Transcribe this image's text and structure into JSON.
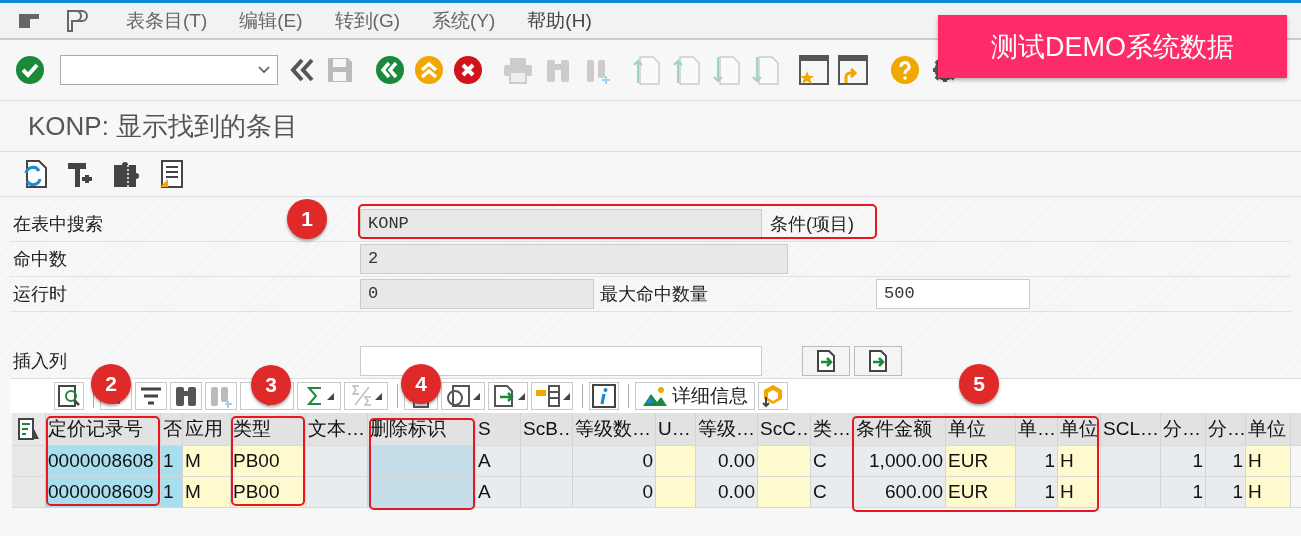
{
  "menu_bar": {
    "items": [
      "表条目(T)",
      "编辑(E)",
      "转到(G)",
      "系统(Y)",
      "帮助(H)"
    ]
  },
  "banner": {
    "text": "测试DEMO系统数据"
  },
  "title": "KONP: 显示找到的条目",
  "form": {
    "rows": [
      {
        "label": "在表中搜索",
        "fields": [
          {
            "value": "KONP",
            "disabled": true,
            "description": "条件(项目)"
          }
        ]
      },
      {
        "label": "命中数",
        "fields": [
          {
            "value": "2",
            "disabled": true
          }
        ]
      },
      {
        "label": "运行时",
        "fields": [
          {
            "value": "0",
            "disabled": true
          },
          {
            "label": "最大命中数量",
            "value": "500",
            "disabled": false
          }
        ]
      },
      {
        "label": "插入列",
        "fields": [
          {
            "disabled": false
          }
        ]
      }
    ]
  },
  "grid_toolbar": {
    "details_button": "详细信息"
  },
  "table": {
    "columns": [
      {
        "header": "定价记录号",
        "kind": "key"
      },
      {
        "header": "否",
        "kind": "key"
      },
      {
        "header": "应用",
        "kind": "input"
      },
      {
        "header": "类型",
        "kind": "input"
      },
      {
        "header": "文本…",
        "kind": "plain"
      },
      {
        "header": "删除标识",
        "kind": "marked"
      },
      {
        "header": "S",
        "kind": "plain"
      },
      {
        "header": "ScB…",
        "kind": "plain"
      },
      {
        "header": "等级数…",
        "kind": "plain"
      },
      {
        "header": "U…",
        "kind": "input"
      },
      {
        "header": "等级…",
        "kind": "plain"
      },
      {
        "header": "ScC…",
        "kind": "input"
      },
      {
        "header": "类…",
        "kind": "plain"
      },
      {
        "header": "条件金额",
        "kind": "plain"
      },
      {
        "header": "单位",
        "kind": "input"
      },
      {
        "header": "单…",
        "kind": "plain"
      },
      {
        "header": "单位",
        "kind": "input"
      },
      {
        "header": "SCL…",
        "kind": "plain"
      },
      {
        "header": "分…",
        "kind": "plain"
      },
      {
        "header": "分…",
        "kind": "plain"
      },
      {
        "header": "单位",
        "kind": "input"
      }
    ],
    "rows": [
      [
        "0000008608",
        "1",
        "M",
        "PB00",
        "",
        "",
        "A",
        "",
        "0",
        "",
        "0.00",
        "",
        "C",
        "1,000.00",
        "EUR",
        "1",
        "H",
        "",
        "1",
        "1",
        "H"
      ],
      [
        "0000008609",
        "1",
        "M",
        "PB00",
        "",
        "",
        "A",
        "",
        "0",
        "",
        "0.00",
        "",
        "C",
        "600.00",
        "EUR",
        "1",
        "H",
        "",
        "1",
        "1",
        "H"
      ]
    ]
  },
  "annotations": [
    {
      "number": "1"
    },
    {
      "number": "2"
    },
    {
      "number": "3"
    },
    {
      "number": "4"
    },
    {
      "number": "5"
    }
  ]
}
